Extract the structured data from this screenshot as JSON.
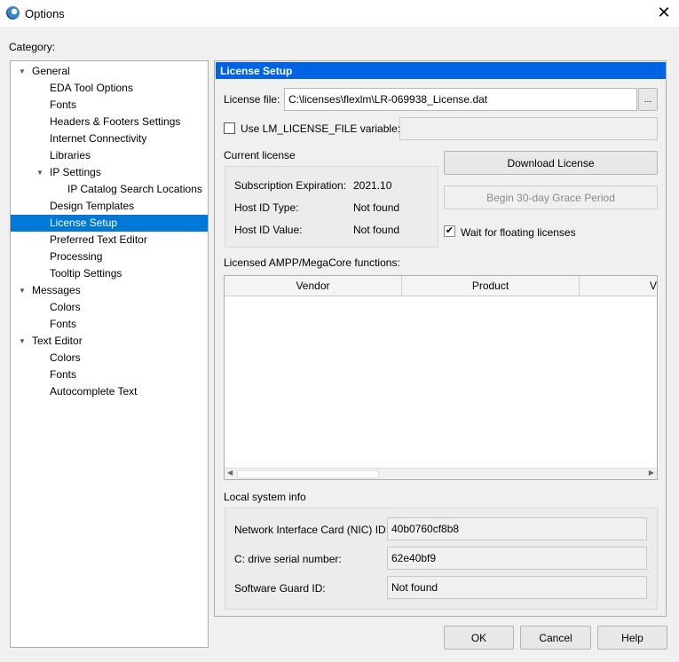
{
  "window": {
    "title": "Options",
    "close": "✕"
  },
  "category_label": "Category:",
  "tree": [
    {
      "label": "General",
      "level": 0,
      "expanded": true
    },
    {
      "label": "EDA Tool Options",
      "level": 1
    },
    {
      "label": "Fonts",
      "level": 1
    },
    {
      "label": "Headers & Footers Settings",
      "level": 1
    },
    {
      "label": "Internet Connectivity",
      "level": 1
    },
    {
      "label": "Libraries",
      "level": 1
    },
    {
      "label": "IP Settings",
      "level": 1,
      "expanded": true
    },
    {
      "label": "IP Catalog Search Locations",
      "level": 2
    },
    {
      "label": "Design Templates",
      "level": 1
    },
    {
      "label": "License Setup",
      "level": 1,
      "selected": true
    },
    {
      "label": "Preferred Text Editor",
      "level": 1
    },
    {
      "label": "Processing",
      "level": 1
    },
    {
      "label": "Tooltip Settings",
      "level": 1
    },
    {
      "label": "Messages",
      "level": 0,
      "expanded": true
    },
    {
      "label": "Colors",
      "level": 1
    },
    {
      "label": "Fonts",
      "level": 1
    },
    {
      "label": "Text Editor",
      "level": 0,
      "expanded": true
    },
    {
      "label": "Colors",
      "level": 1
    },
    {
      "label": "Fonts",
      "level": 1
    },
    {
      "label": "Autocomplete Text",
      "level": 1
    }
  ],
  "panel": {
    "header": "License Setup",
    "license_file_label": "License file:",
    "license_file_value": "C:\\licenses\\flexlm\\LR-069938_License.dat",
    "browse": "...",
    "use_lm_label": "Use LM_LICENSE_FILE variable:",
    "use_lm_checked": false,
    "lm_value": "",
    "current_license": "Current license",
    "sub_exp_label": "Subscription Expiration:",
    "sub_exp_value": "2021.10",
    "host_type_label": "Host ID Type:",
    "host_type_value": "Not found",
    "host_value_label": "Host ID Value:",
    "host_value_value": "Not found",
    "download": "Download License",
    "grace": "Begin 30-day Grace Period",
    "wait_label": "Wait for floating licenses",
    "wait_checked": true,
    "licensed_label": "Licensed AMPP/MegaCore functions:",
    "columns": [
      "Vendor",
      "Product",
      "V"
    ],
    "local_info": "Local system info",
    "nic_label": "Network Interface Card (NIC) ID:",
    "nic_value": "40b0760cf8b8",
    "drive_label": "C: drive serial number:",
    "drive_value": "62e40bf9",
    "guard_label": "Software Guard ID:",
    "guard_value": "Not found"
  },
  "buttons": {
    "ok": "OK",
    "cancel": "Cancel",
    "help": "Help"
  }
}
